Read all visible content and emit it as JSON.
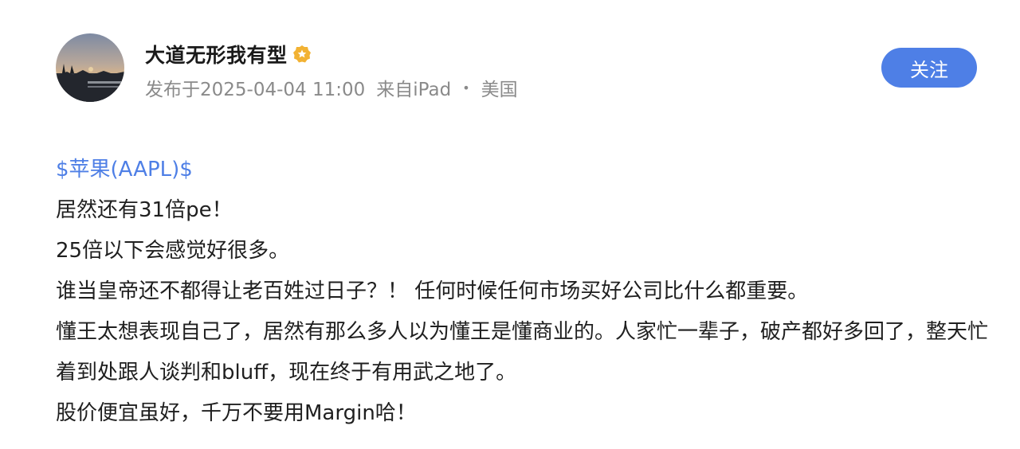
{
  "author": {
    "name": "大道无形我有型",
    "badge_icon": "verified-star-badge"
  },
  "meta": {
    "published": "发布于2025-04-04 11:00",
    "source": "来自iPad",
    "separator": "•",
    "location": "美国"
  },
  "actions": {
    "follow_label": "关注"
  },
  "post": {
    "stock_tag": "$苹果(AAPL)$",
    "lines": [
      "居然还有31倍pe！",
      "25倍以下会感觉好很多。",
      "谁当皇帝还不都得让老百姓过日子？！ 任何时候任何市场买好公司比什么都重要。",
      "懂王太想表现自己了，居然有那么多人以为懂王是懂商业的。人家忙一辈子，破产都好多回了，整天忙着到处跟人谈判和bluff，现在终于有用武之地了。",
      "股价便宜虽好，千万不要用Margin哈！"
    ]
  },
  "colors": {
    "accent": "#4e7fe6",
    "meta_text": "#8a8a8a",
    "body_text": "#1f1f1f"
  }
}
